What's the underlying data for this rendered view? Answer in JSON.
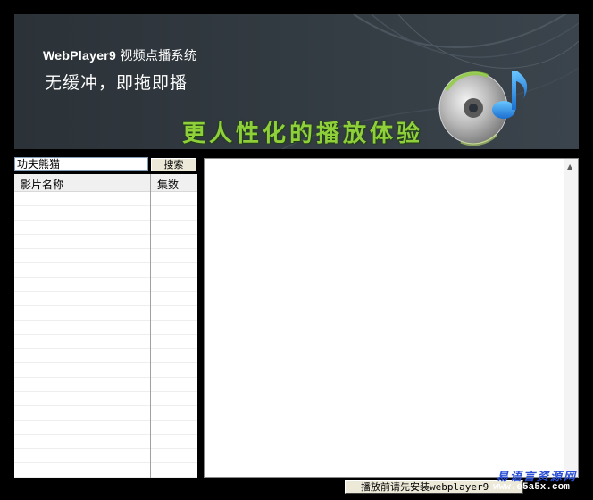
{
  "banner": {
    "app_name": "WebPlayer9",
    "app_desc": "视频点播系统",
    "subtitle": "无缓冲，即拖即播",
    "slogan": "更人性化的播放体验",
    "graphic_icon": "disc-music-note-icon"
  },
  "search": {
    "value": "功夫熊猫",
    "button_label": "搜索"
  },
  "list": {
    "columns": [
      "影片名称",
      "集数"
    ]
  },
  "status": {
    "button_label": "播放前请先安装webplayer9"
  },
  "watermark": {
    "top": "易语言资源网",
    "bottom": "www.e5a5x.com"
  },
  "colors": {
    "banner_bg": "#2a3138",
    "slogan_green": "#8fd03a",
    "watermark_blue": "#2a4fd6"
  }
}
